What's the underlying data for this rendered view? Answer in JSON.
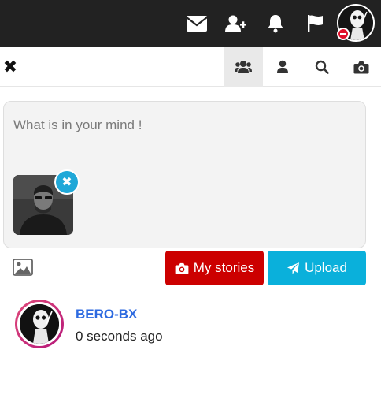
{
  "header": {
    "icons": [
      "envelope-icon",
      "user-plus-icon",
      "bell-icon",
      "flag-icon"
    ],
    "status_color": "#e0102a"
  },
  "toolbar": {
    "close_label": "✖",
    "tabs": [
      "users-icon",
      "user-icon",
      "search-icon",
      "camera-icon"
    ],
    "active_tab": "users-icon"
  },
  "composer": {
    "placeholder": "What is in your mind !",
    "value": "",
    "remove_label": "✖"
  },
  "actions": {
    "my_stories_label": "My stories",
    "upload_label": "Upload",
    "my_stories_color": "#cc0000",
    "upload_color": "#0ab0db"
  },
  "post": {
    "username": "BERO-BX",
    "timestamp": "0 seconds ago",
    "username_color": "#2d6ae0"
  }
}
